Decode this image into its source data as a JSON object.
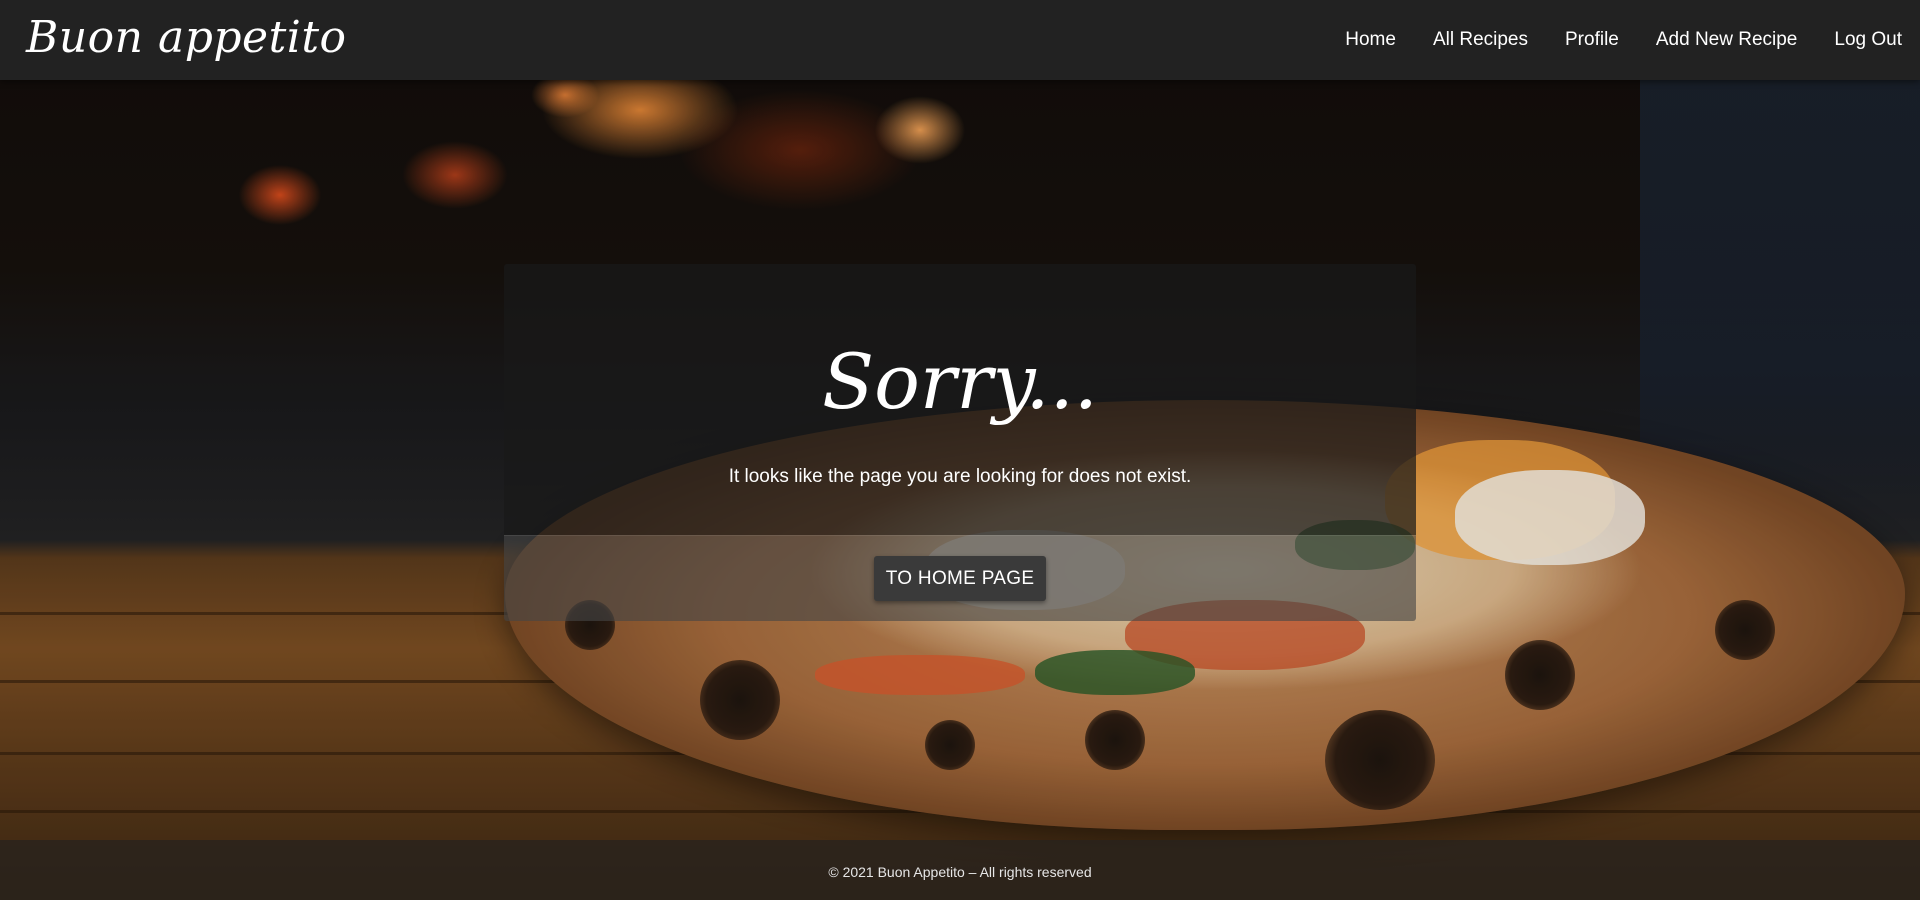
{
  "brand": {
    "name": "Buon appetito"
  },
  "nav": {
    "items": [
      {
        "label": "Home"
      },
      {
        "label": "All Recipes"
      },
      {
        "label": "Profile"
      },
      {
        "label": "Add New Recipe"
      },
      {
        "label": "Log Out"
      }
    ]
  },
  "error_card": {
    "title": "Sorry...",
    "message": "It looks like the page you are looking for does not exist.",
    "button_label": "TO HOME PAGE"
  },
  "footer": {
    "text": "© 2021 Buon Appetito – All rights reserved"
  },
  "colors": {
    "navbar_bg": "#222222",
    "text": "#ffffff",
    "button_bg": "#3a3a3a"
  }
}
